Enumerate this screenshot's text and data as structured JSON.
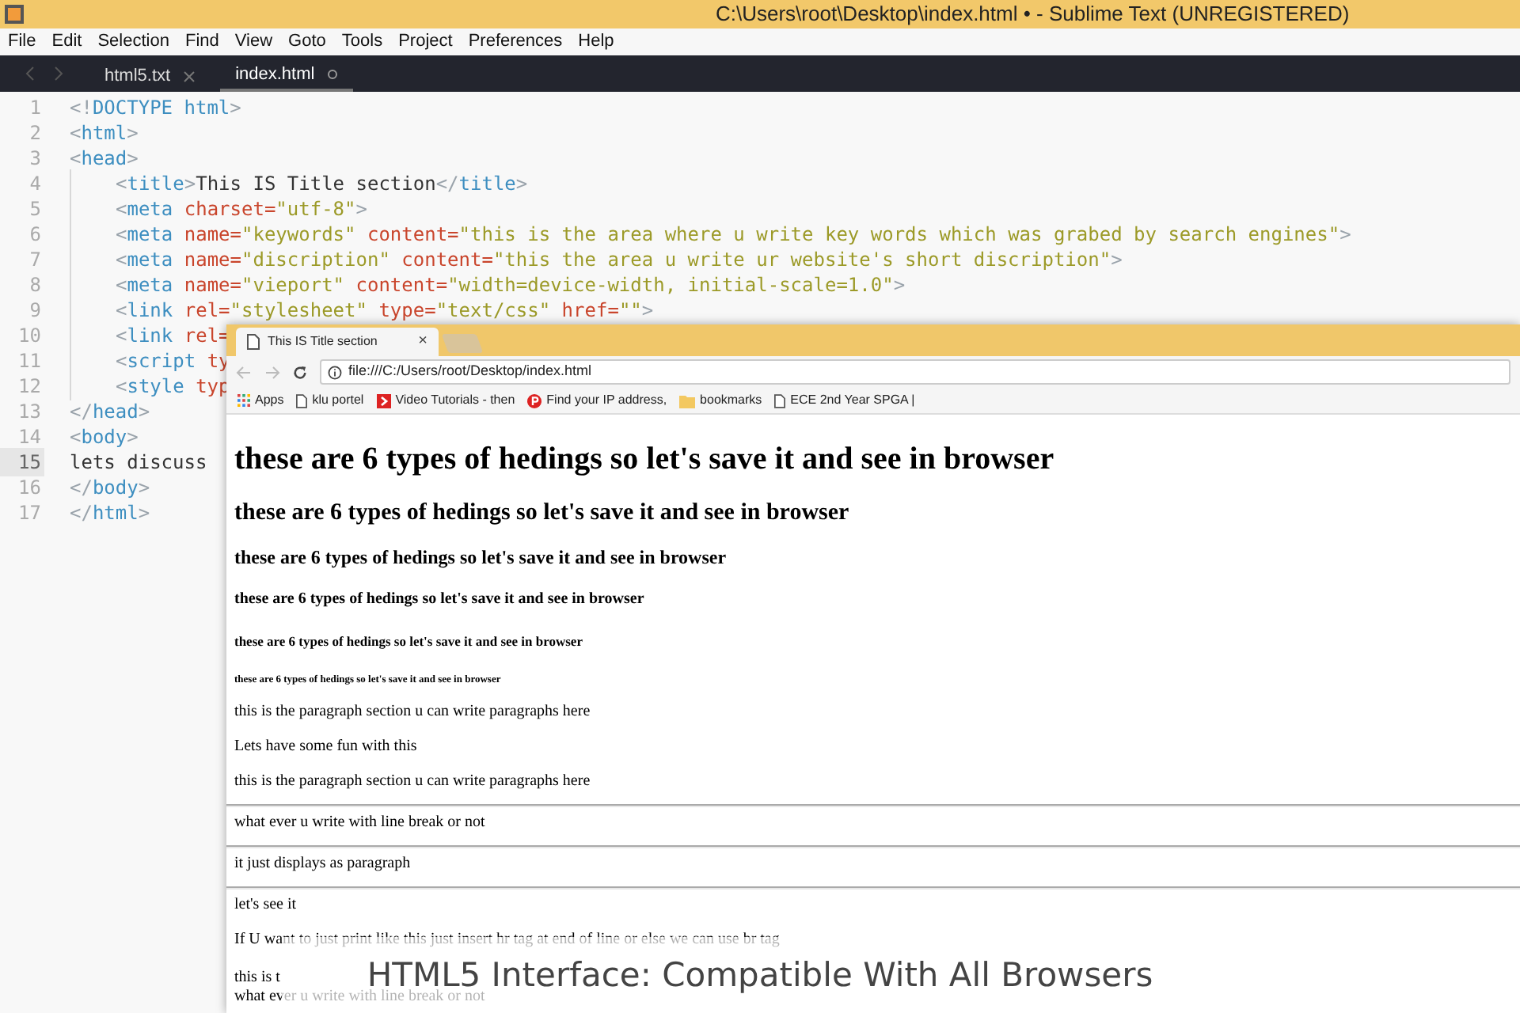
{
  "window": {
    "title": "C:\\Users\\root\\Desktop\\index.html • - Sublime Text (UNREGISTERED)"
  },
  "menu": [
    "File",
    "Edit",
    "Selection",
    "Find",
    "View",
    "Goto",
    "Tools",
    "Project",
    "Preferences",
    "Help"
  ],
  "tabs": [
    {
      "label": "html5.txt",
      "selected": false,
      "modified": false
    },
    {
      "label": "index.html",
      "selected": true,
      "modified": true
    }
  ],
  "editor": {
    "lines": [
      {
        "number": "1",
        "indented": false,
        "current": false,
        "tokens": [
          {
            "kind": "punct",
            "text": "<!"
          },
          {
            "kind": "tag",
            "text": "DOCTYPE html"
          },
          {
            "kind": "punct",
            "text": ">"
          }
        ]
      },
      {
        "number": "2",
        "indented": false,
        "current": false,
        "tokens": [
          {
            "kind": "punct",
            "text": "<"
          },
          {
            "kind": "tag",
            "text": "html"
          },
          {
            "kind": "punct",
            "text": ">"
          }
        ]
      },
      {
        "number": "3",
        "indented": false,
        "current": false,
        "tokens": [
          {
            "kind": "punct",
            "text": "<"
          },
          {
            "kind": "tag",
            "text": "head"
          },
          {
            "kind": "punct",
            "text": ">"
          }
        ]
      },
      {
        "number": "4",
        "indented": true,
        "current": false,
        "tokens": [
          {
            "kind": "punct",
            "text": "<"
          },
          {
            "kind": "tag",
            "text": "title"
          },
          {
            "kind": "punct",
            "text": ">"
          },
          {
            "kind": "text",
            "text": "This IS Title section"
          },
          {
            "kind": "punct",
            "text": "</"
          },
          {
            "kind": "tag",
            "text": "title"
          },
          {
            "kind": "punct",
            "text": ">"
          }
        ]
      },
      {
        "number": "5",
        "indented": true,
        "current": false,
        "tokens": [
          {
            "kind": "punct",
            "text": "<"
          },
          {
            "kind": "tag",
            "text": "meta"
          },
          {
            "kind": "attr",
            "text": " charset="
          },
          {
            "kind": "str",
            "text": "\"utf-8\""
          },
          {
            "kind": "punct",
            "text": ">"
          }
        ]
      },
      {
        "number": "6",
        "indented": true,
        "current": false,
        "tokens": [
          {
            "kind": "punct",
            "text": "<"
          },
          {
            "kind": "tag",
            "text": "meta"
          },
          {
            "kind": "attr",
            "text": " name="
          },
          {
            "kind": "str",
            "text": "\"keywords\""
          },
          {
            "kind": "attr",
            "text": " content="
          },
          {
            "kind": "str",
            "text": "\"this is the area where u write key words which was grabed by search engines\""
          },
          {
            "kind": "punct",
            "text": ">"
          }
        ]
      },
      {
        "number": "7",
        "indented": true,
        "current": false,
        "tokens": [
          {
            "kind": "punct",
            "text": "<"
          },
          {
            "kind": "tag",
            "text": "meta"
          },
          {
            "kind": "attr",
            "text": " name="
          },
          {
            "kind": "str",
            "text": "\"discription\""
          },
          {
            "kind": "attr",
            "text": " content="
          },
          {
            "kind": "str",
            "text": "\"this the area u write ur website's short discription\""
          },
          {
            "kind": "punct",
            "text": ">"
          }
        ]
      },
      {
        "number": "8",
        "indented": true,
        "current": false,
        "tokens": [
          {
            "kind": "punct",
            "text": "<"
          },
          {
            "kind": "tag",
            "text": "meta"
          },
          {
            "kind": "attr",
            "text": " name="
          },
          {
            "kind": "str",
            "text": "\"vieport\""
          },
          {
            "kind": "attr",
            "text": " content="
          },
          {
            "kind": "str",
            "text": "\"width=device-width, initial-scale=1.0\""
          },
          {
            "kind": "punct",
            "text": ">"
          }
        ]
      },
      {
        "number": "9",
        "indented": true,
        "current": false,
        "tokens": [
          {
            "kind": "punct",
            "text": "<"
          },
          {
            "kind": "tag",
            "text": "link"
          },
          {
            "kind": "attr",
            "text": " rel="
          },
          {
            "kind": "str",
            "text": "\"stylesheet\""
          },
          {
            "kind": "attr",
            "text": " type="
          },
          {
            "kind": "str",
            "text": "\"text/css\""
          },
          {
            "kind": "attr",
            "text": " href="
          },
          {
            "kind": "str",
            "text": "\"\""
          },
          {
            "kind": "punct",
            "text": ">"
          }
        ]
      },
      {
        "number": "10",
        "indented": true,
        "current": false,
        "tokens": [
          {
            "kind": "punct",
            "text": "<"
          },
          {
            "kind": "tag",
            "text": "link"
          },
          {
            "kind": "attr",
            "text": " rel="
          }
        ]
      },
      {
        "number": "11",
        "indented": true,
        "current": false,
        "tokens": [
          {
            "kind": "punct",
            "text": "<"
          },
          {
            "kind": "tag",
            "text": "script"
          },
          {
            "kind": "attr",
            "text": " ty"
          }
        ]
      },
      {
        "number": "12",
        "indented": true,
        "current": false,
        "tokens": [
          {
            "kind": "punct",
            "text": "<"
          },
          {
            "kind": "tag",
            "text": "style"
          },
          {
            "kind": "attr",
            "text": " typ"
          }
        ]
      },
      {
        "number": "13",
        "indented": false,
        "current": false,
        "tokens": [
          {
            "kind": "punct",
            "text": "</"
          },
          {
            "kind": "tag",
            "text": "head"
          },
          {
            "kind": "punct",
            "text": ">"
          }
        ]
      },
      {
        "number": "14",
        "indented": false,
        "current": false,
        "tokens": [
          {
            "kind": "punct",
            "text": "<"
          },
          {
            "kind": "tag",
            "text": "body"
          },
          {
            "kind": "punct",
            "text": ">"
          }
        ]
      },
      {
        "number": "15",
        "indented": false,
        "current": true,
        "tokens": [
          {
            "kind": "text",
            "text": "lets discuss"
          }
        ]
      },
      {
        "number": "16",
        "indented": false,
        "current": false,
        "tokens": [
          {
            "kind": "punct",
            "text": "</"
          },
          {
            "kind": "tag",
            "text": "body"
          },
          {
            "kind": "punct",
            "text": ">"
          }
        ]
      },
      {
        "number": "17",
        "indented": false,
        "current": false,
        "tokens": [
          {
            "kind": "punct",
            "text": "</"
          },
          {
            "kind": "tag",
            "text": "html"
          },
          {
            "kind": "punct",
            "text": ">"
          }
        ]
      }
    ]
  },
  "browser": {
    "tab": {
      "title": "This IS Title section",
      "close": "×"
    },
    "address": "file:///C:/Users/root/Desktop/index.html",
    "bookmarks": [
      {
        "kind": "apps",
        "label": "Apps"
      },
      {
        "kind": "page",
        "label": "klu portel"
      },
      {
        "kind": "video",
        "label": "Video Tutorials - then"
      },
      {
        "kind": "pin",
        "label": "Find your IP address,"
      },
      {
        "kind": "folder",
        "label": "bookmarks"
      },
      {
        "kind": "page",
        "label": "ECE 2nd Year SPGA |"
      }
    ],
    "content": [
      {
        "kind": "h1",
        "text": "these are 6 types of hedings so let's save it and see in browser"
      },
      {
        "kind": "h2",
        "text": "these are 6 types of hedings so let's save it and see in browser"
      },
      {
        "kind": "h3",
        "text": "these are 6 types of hedings so let's save it and see in browser"
      },
      {
        "kind": "h4",
        "text": "these are 6 types of hedings so let's save it and see in browser"
      },
      {
        "kind": "h5",
        "text": "these are 6 types of hedings so let's save it and see in browser"
      },
      {
        "kind": "h6",
        "text": "these are 6 types of hedings so let's save it and see in browser"
      },
      {
        "kind": "p",
        "lines": [
          "this is the paragraph section u can write paragraphs here"
        ]
      },
      {
        "kind": "p",
        "lines": [
          "Lets have some fun with this"
        ]
      },
      {
        "kind": "p",
        "lines": [
          "this is the paragraph section u can write paragraphs here"
        ]
      },
      {
        "kind": "hr"
      },
      {
        "kind": "p",
        "lines": [
          "what ever u write with line break or not"
        ]
      },
      {
        "kind": "hr"
      },
      {
        "kind": "p",
        "lines": [
          "it just displays as paragraph"
        ]
      },
      {
        "kind": "hr"
      },
      {
        "kind": "p",
        "lines": [
          "let's see it"
        ]
      },
      {
        "kind": "p",
        "lines": [
          "If U want to just print like this just insert hr tag at end of line or else we can use br tag"
        ]
      },
      {
        "kind": "p",
        "lines": [
          "this is t",
          "what ever u write with line break or not"
        ]
      }
    ]
  },
  "caption": "HTML5 Interface: Compatible With All Browsers"
}
